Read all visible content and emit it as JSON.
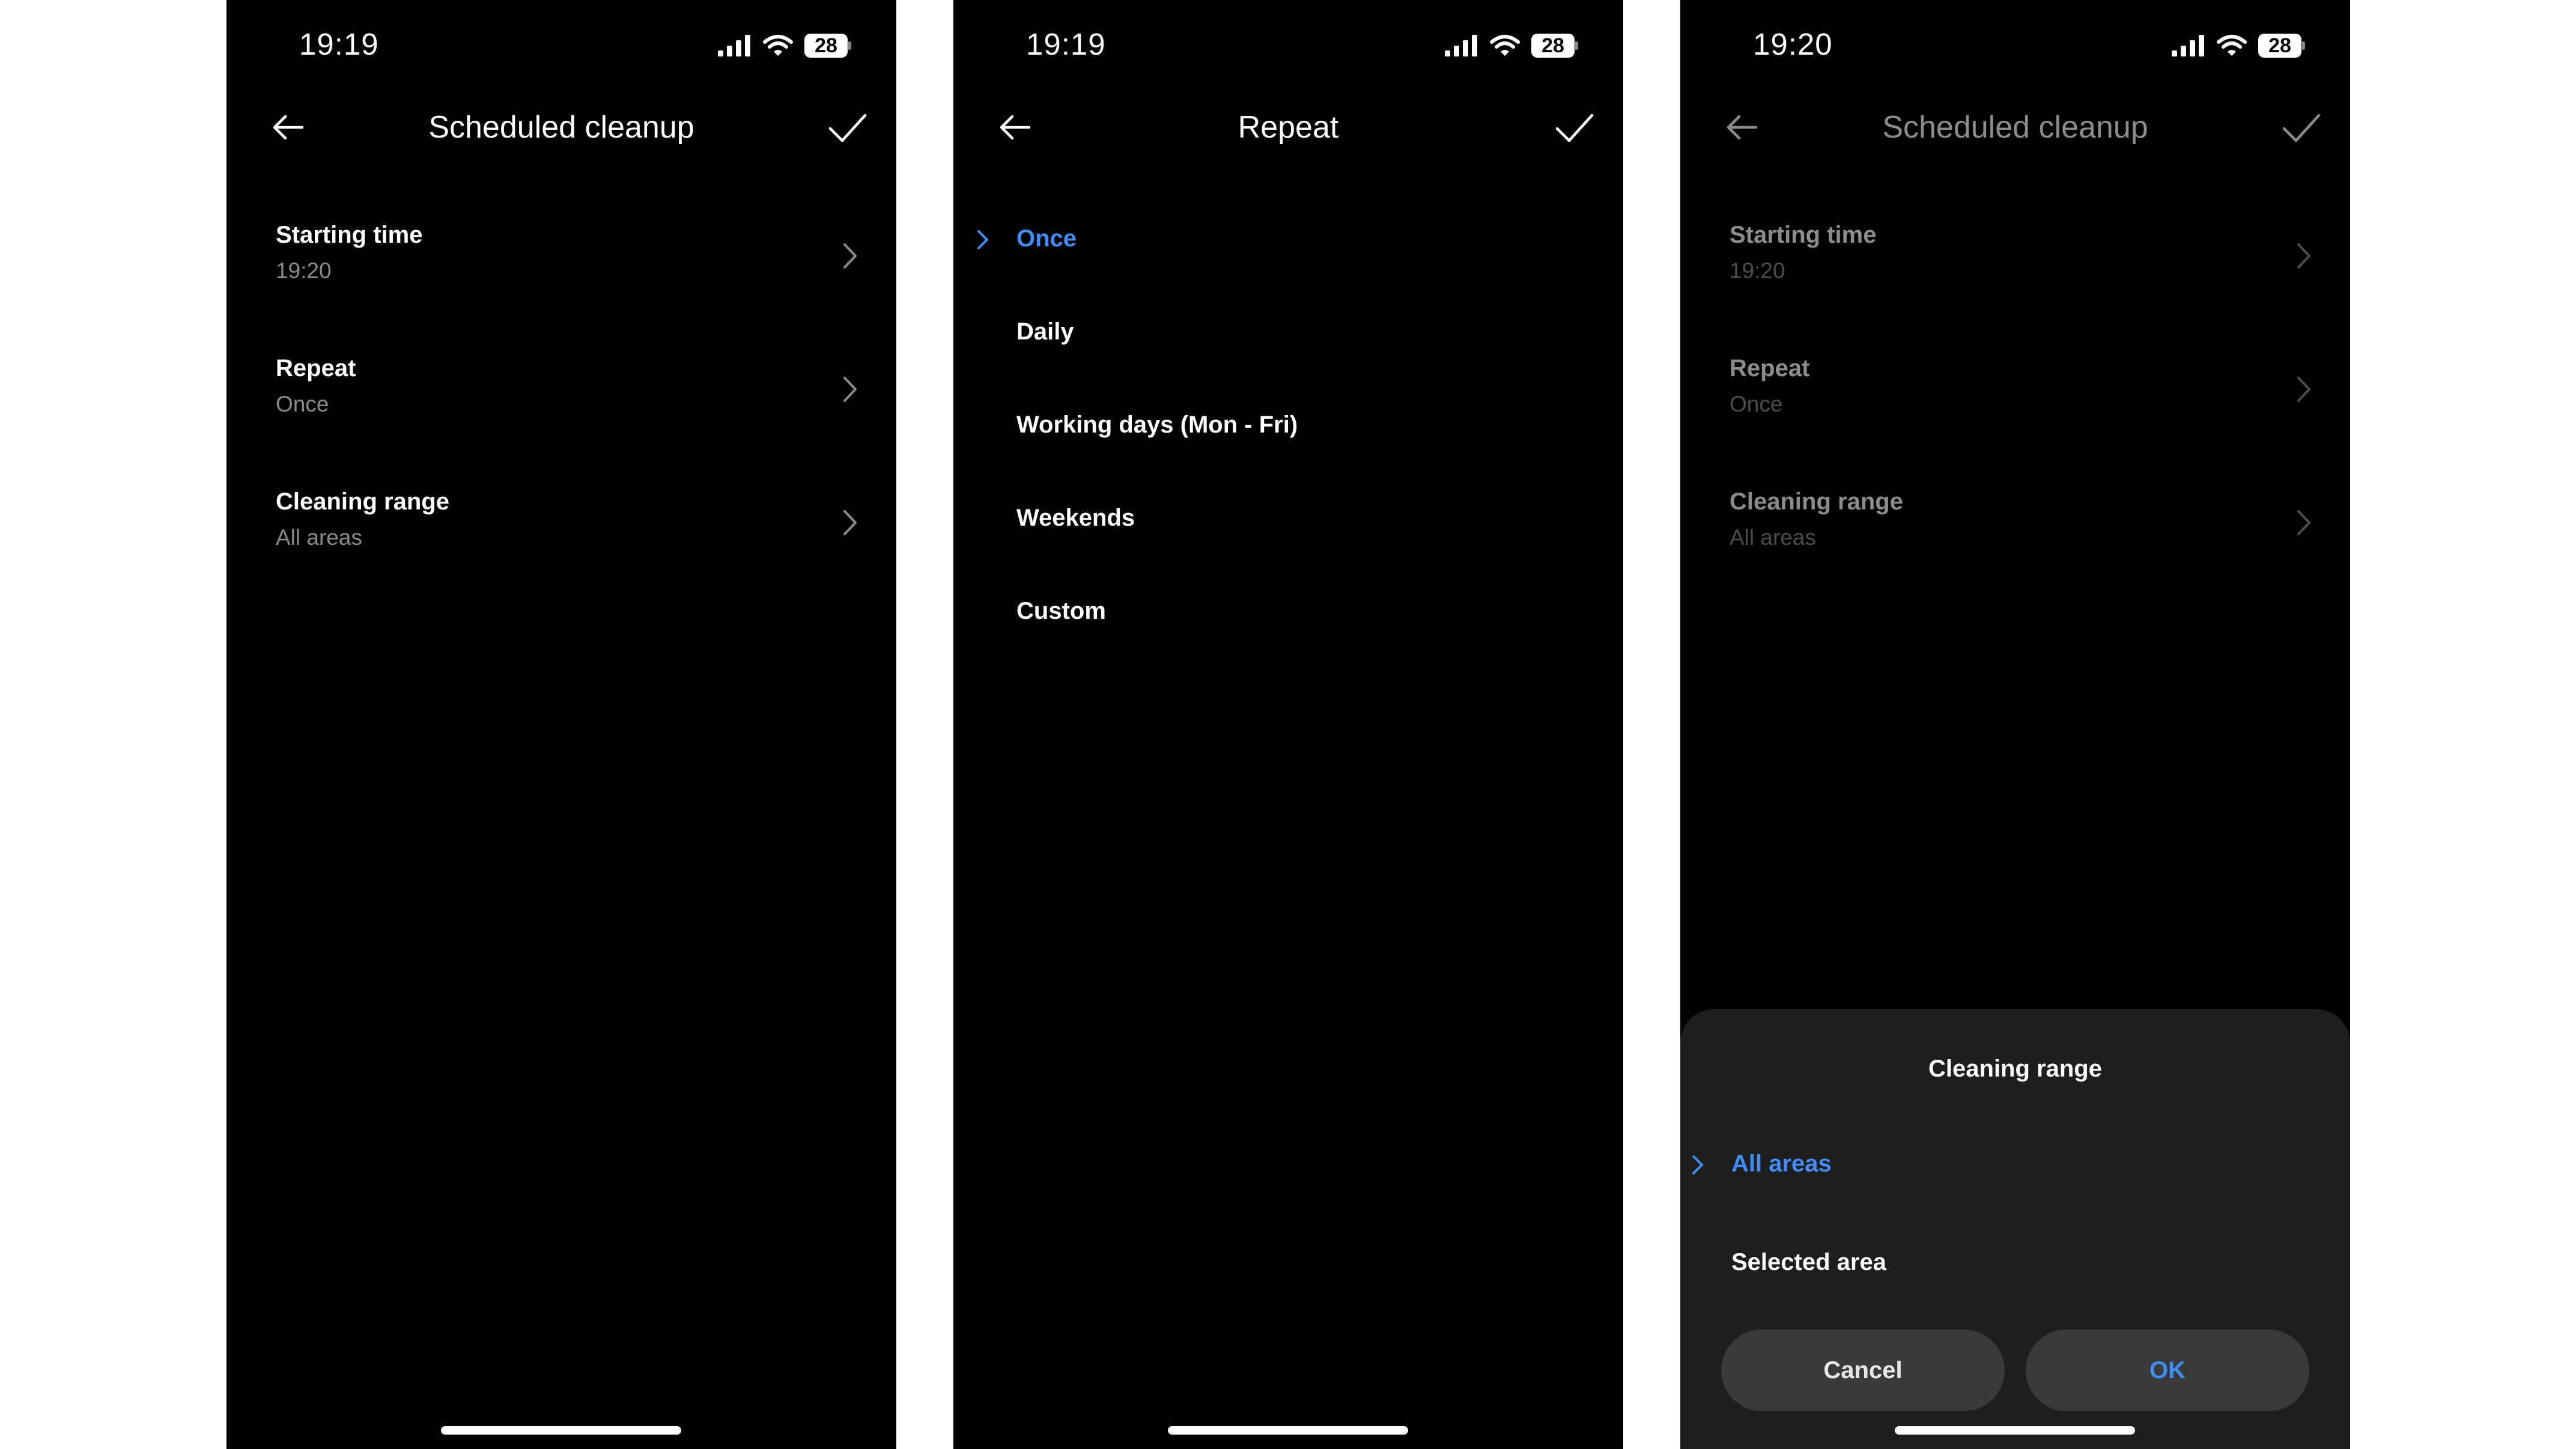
{
  "colors": {
    "background": "#000000",
    "sheet": "#1e1e1e",
    "accent": "#3f8ef5",
    "secondary_text": "#8a8a8a",
    "button": "#3a3a3a"
  },
  "screens": [
    {
      "status": {
        "time": "19:19",
        "battery": "28",
        "icons": [
          "cellular-signal-icon",
          "wifi-icon",
          "battery-icon"
        ]
      },
      "header": {
        "title": "Scheduled cleanup",
        "back_icon": "arrow-left-icon",
        "confirm_icon": "checkmark-icon"
      },
      "settings": [
        {
          "label": "Starting time",
          "value": "19:20"
        },
        {
          "label": "Repeat",
          "value": "Once"
        },
        {
          "label": "Cleaning range",
          "value": "All areas"
        }
      ]
    },
    {
      "status": {
        "time": "19:19",
        "battery": "28"
      },
      "header": {
        "title": "Repeat"
      },
      "options": [
        {
          "label": "Once",
          "selected": true
        },
        {
          "label": "Daily",
          "selected": false
        },
        {
          "label": "Working days (Mon - Fri)",
          "selected": false
        },
        {
          "label": "Weekends",
          "selected": false
        },
        {
          "label": "Custom",
          "selected": false
        }
      ]
    },
    {
      "status": {
        "time": "19:20",
        "battery": "28"
      },
      "header": {
        "title": "Scheduled cleanup"
      },
      "settings": [
        {
          "label": "Starting time",
          "value": "19:20"
        },
        {
          "label": "Repeat",
          "value": "Once"
        },
        {
          "label": "Cleaning range",
          "value": "All areas"
        }
      ],
      "sheet": {
        "title": "Cleaning range",
        "options": [
          {
            "label": "All areas",
            "selected": true
          },
          {
            "label": "Selected area",
            "selected": false
          }
        ],
        "cancel_label": "Cancel",
        "ok_label": "OK"
      }
    }
  ]
}
